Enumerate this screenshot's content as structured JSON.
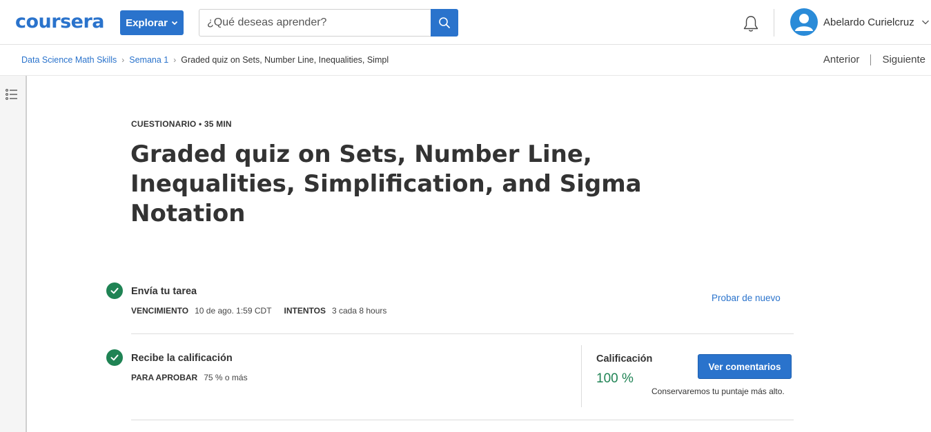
{
  "header": {
    "logo_text": "coursera",
    "explore_label": "Explorar",
    "search_placeholder": "¿Qué deseas aprender?",
    "user_name": "Abelardo Curielcruz"
  },
  "breadcrumb": {
    "items": [
      "Data Science Math Skills",
      "Semana 1"
    ],
    "current": "Graded quiz on Sets, Number Line, Inequalities, Simpl"
  },
  "nav": {
    "previous": "Anterior",
    "next": "Siguiente"
  },
  "quiz": {
    "meta": "CUESTIONARIO • 35 MIN",
    "title": "Graded quiz on Sets, Number Line, Inequalities, Simplification, and Sigma Notation"
  },
  "submit_step": {
    "title": "Envía tu tarea",
    "due_label": "VENCIMIENTO",
    "due_value": "10 de ago. 1:59 CDT",
    "attempts_label": "INTENTOS",
    "attempts_value": "3 cada 8 hours",
    "retry_link": "Probar de nuevo"
  },
  "grade_step": {
    "title": "Recibe la calificación",
    "pass_label": "PARA APROBAR",
    "pass_value": "75 % o más",
    "grade_label": "Calificación",
    "grade_value": "100 %",
    "feedback_button": "Ver comentarios",
    "keep_note": "Conservaremos tu puntaje más alto."
  },
  "colors": {
    "brand_blue": "#2a73cc",
    "success_green": "#1f8354"
  },
  "icons": [
    "chevron-down-icon",
    "search-icon",
    "bell-icon",
    "user-avatar-icon",
    "outline-list-icon",
    "check-circle-icon"
  ]
}
